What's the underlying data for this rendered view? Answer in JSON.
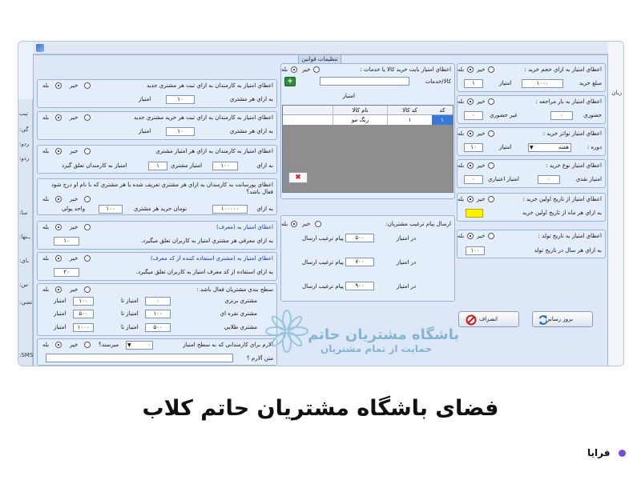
{
  "window": {
    "title": "تنظیمات قوانین"
  },
  "left_strip": [
    "تيب",
    "گي:",
    "ردو:",
    "ردو:",
    "سا:",
    "ــنها:",
    "ـاى:",
    "س:",
    "تضي:",
    "SMS:"
  ],
  "right_strip": [
    "زبان"
  ],
  "common": {
    "yes": "بله",
    "no": "خیر",
    "points": "امتیاز"
  },
  "panels": {
    "reg_customer": {
      "title": "اعطاي امتياز به كارمندان به ازاي ثبت هر مشتري جديد",
      "label": "به ازاي هر مشتري",
      "value": "۱۰"
    },
    "reg_purchase": {
      "title": "اعطاي امتياز به كارمندان به ازاي ثبت هر خريد مشتري جديد",
      "label": "به ازاي هر مشتري",
      "value": "۱۰"
    },
    "customer_points": {
      "title": "اعطاي امتياز به كارمندان به ازاي هر امتياز مشتري",
      "label1": "به ازاي",
      "value1": "۱۰۰",
      "label2": "امتياز مشتري",
      "value2": "۱",
      "label3": "امتياز به كارمندان تعلق گيرد"
    },
    "defined_purchase": {
      "title": "اعطاي پورسانت به كارمندان به ازاي هر مشتري تعريف شده يا هر مشتري كه با نام او درج شود فعال باشد؟",
      "label1": "به ازاي",
      "value1": "۱۰۰۰۰۰",
      "label2": "تومان خريد هر مشتري",
      "value2": "۱۰۰",
      "label3": "واحد پولي"
    },
    "referrer": {
      "title": "اعطاي امتياز به (معرف)",
      "label": "به ازاي معرفي هر مشتري امتياز به كاربران تعلق ميگيرد.",
      "value": "۱۰"
    },
    "code_user": {
      "title": "اعطاي امتياز به (مشتري استفاده كننده از كد معرف)",
      "label": "به ازاي استفاده از كد معرف امتياز به كاربران تعلق ميگيرد.",
      "value": "۲۰"
    },
    "levels": {
      "title": "سطح بندي مشتريان فعال باشد :",
      "rows": [
        {
          "name": "مشتري برنزي",
          "from_label": "امتياز تا",
          "from": "۰",
          "to_label": "امتياز",
          "to": "۱۰۰"
        },
        {
          "name": "مشتري نقره اي",
          "from_label": "امتياز تا",
          "from": "۱۰۰",
          "to_label": "امتياز",
          "to": "۵۰۰"
        },
        {
          "name": "مشتري طلايي",
          "from_label": "امتياز تا",
          "from": "۵۰۰",
          "to_label": "امتياز",
          "to": "۱۰۰۰"
        }
      ]
    },
    "alarm": {
      "title": "آلارم براي كارمندانى كه به سطح امتياز",
      "mid": "ميرسند؟",
      "value": "۰",
      "label": "متن آلارم ؟"
    },
    "product_service": {
      "title": "اعطاي امتياز بابت خريد كالا يا خدمات :",
      "field_label": "كالا/خدمات",
      "points_label": "امتياز"
    },
    "table": {
      "headers": [
        "كد",
        "كد كالا",
        "نام كالا"
      ],
      "rows": [
        [
          "۱",
          "۱",
          "رنگ مو"
        ]
      ]
    },
    "sms": {
      "title": "ارسال پيام ترغيب مشتريان:",
      "rows": [
        {
          "label": "در امتياز",
          "value": "۵۰۰",
          "text": "پيام ترغيب ارسال"
        },
        {
          "label": "در امتياز",
          "value": "۷۰۰",
          "text": "پيام ترغيب ارسال"
        },
        {
          "label": "در امتياز",
          "value": "۹۰۰",
          "text": "پيام ترغيب ارسال"
        }
      ]
    },
    "volume": {
      "title": "اعطاي امتياز به ازاي حجم خريد :",
      "label1": "مبلغ خريد",
      "value1": "۱۰۰۰",
      "label2": "امتياز",
      "value2": "۱"
    },
    "visits": {
      "title": "اعطاي امتياز به بار مراجعه :",
      "label1": "حضوري",
      "value1": "۰",
      "label2": "غير حضوري",
      "value2": "۰"
    },
    "frequency": {
      "title": "اعطاي امتياز تواتر خريد :",
      "label1": "دوره :",
      "option": "هفته",
      "label2": "امتياز",
      "value2": "۱۰"
    },
    "purchase_type": {
      "title": "اعطاي امتياز نوع خريد :",
      "label1": "امتياز نقدي",
      "value1": "۰",
      "label2": "امتياز اعتباري",
      "value2": "۰"
    },
    "first_purchase": {
      "title": "اعطاي امتياز از تاريخ اولين خريد :",
      "label": "به ازاي هر ماه از تاريخ اولين خريد"
    },
    "birthday": {
      "title": "اعطاي امتياز به تاريخ تولد :",
      "label": "به ازاي هر سال در تاريخ تولد",
      "value": "۱۰۰"
    }
  },
  "buttons": {
    "update": "بروز رساني",
    "cancel": "انصراف"
  },
  "watermark": {
    "title": "باشگاه مشتريان حاتم",
    "subtitle": "حمايت از تمام مشتريان"
  },
  "caption": "فضای باشگاه مشتریان حاتم کلاب",
  "brand": "فرایا"
}
